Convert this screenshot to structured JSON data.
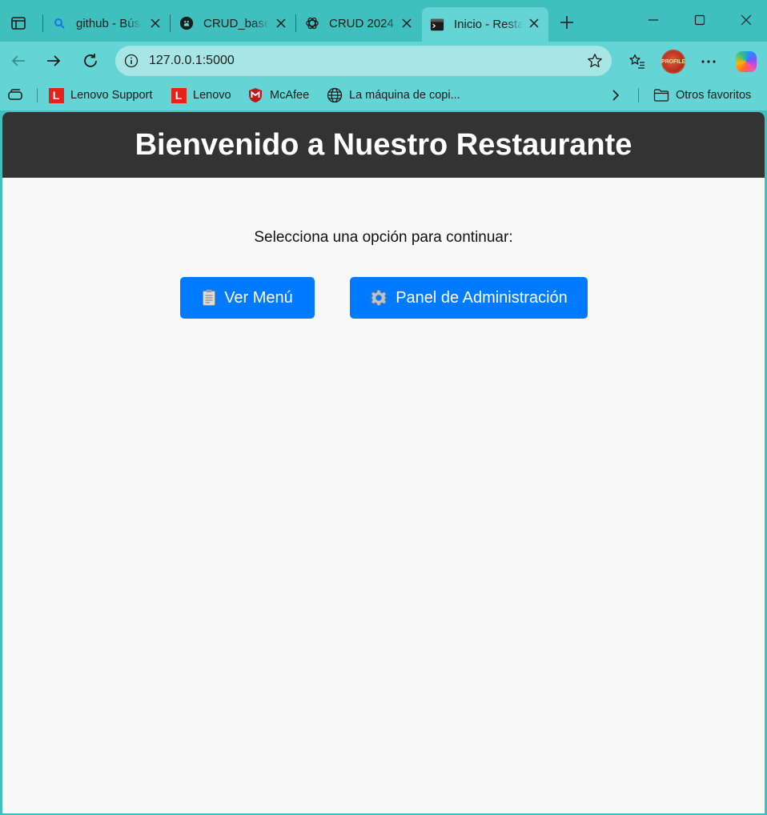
{
  "browser": {
    "tabs": [
      {
        "title": "github - Búsqueda",
        "icon": "search-icon",
        "active": false
      },
      {
        "title": "CRUD_base_datos",
        "icon": "github-icon",
        "active": false
      },
      {
        "title": "CRUD 2024",
        "icon": "chatgpt-icon",
        "active": false
      },
      {
        "title": "Inicio - Restaurante",
        "icon": "terminal-icon",
        "active": true
      }
    ],
    "address": {
      "url": "127.0.0.1:5000"
    },
    "profile": {
      "label": "PROFILE"
    },
    "bookmarks": [
      {
        "label": "Lenovo Support",
        "icon": "lenovo-icon"
      },
      {
        "label": "Lenovo",
        "icon": "lenovo-icon"
      },
      {
        "label": "McAfee",
        "icon": "mcafee-icon"
      },
      {
        "label": "La máquina de copi...",
        "icon": "globe-icon"
      }
    ],
    "other_favorites": "Otros favoritos",
    "colors": {
      "frame": "#3fbfbd",
      "toolbar": "#64d4d4",
      "address_bg": "#a8e6e6"
    }
  },
  "page": {
    "title": "Bienvenido a Nuestro Restaurante",
    "prompt": "Selecciona una opción para continuar:",
    "buttons": {
      "menu": {
        "icon": "clipboard-icon",
        "label": "Ver Menú"
      },
      "admin": {
        "icon": "gear-icon",
        "label": "Panel de Administración"
      }
    },
    "colors": {
      "header_bg": "#333333",
      "button_bg": "#007bff",
      "page_bg": "#f8f8f8"
    }
  }
}
